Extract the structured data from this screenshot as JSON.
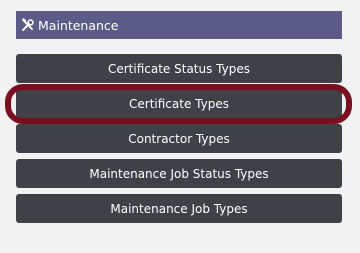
{
  "header": {
    "title": "Maintenance",
    "icon": "tools-icon",
    "background": "#5c5a86"
  },
  "menu": {
    "button_color": "#3f4147",
    "items": [
      {
        "label": "Certificate Status Types"
      },
      {
        "label": "Certificate Types",
        "highlighted": true
      },
      {
        "label": "Contractor Types"
      },
      {
        "label": "Maintenance Job Status Types"
      },
      {
        "label": "Maintenance Job Types"
      }
    ]
  },
  "highlight": {
    "color": "#7a0f1f",
    "target": "Certificate Types"
  }
}
